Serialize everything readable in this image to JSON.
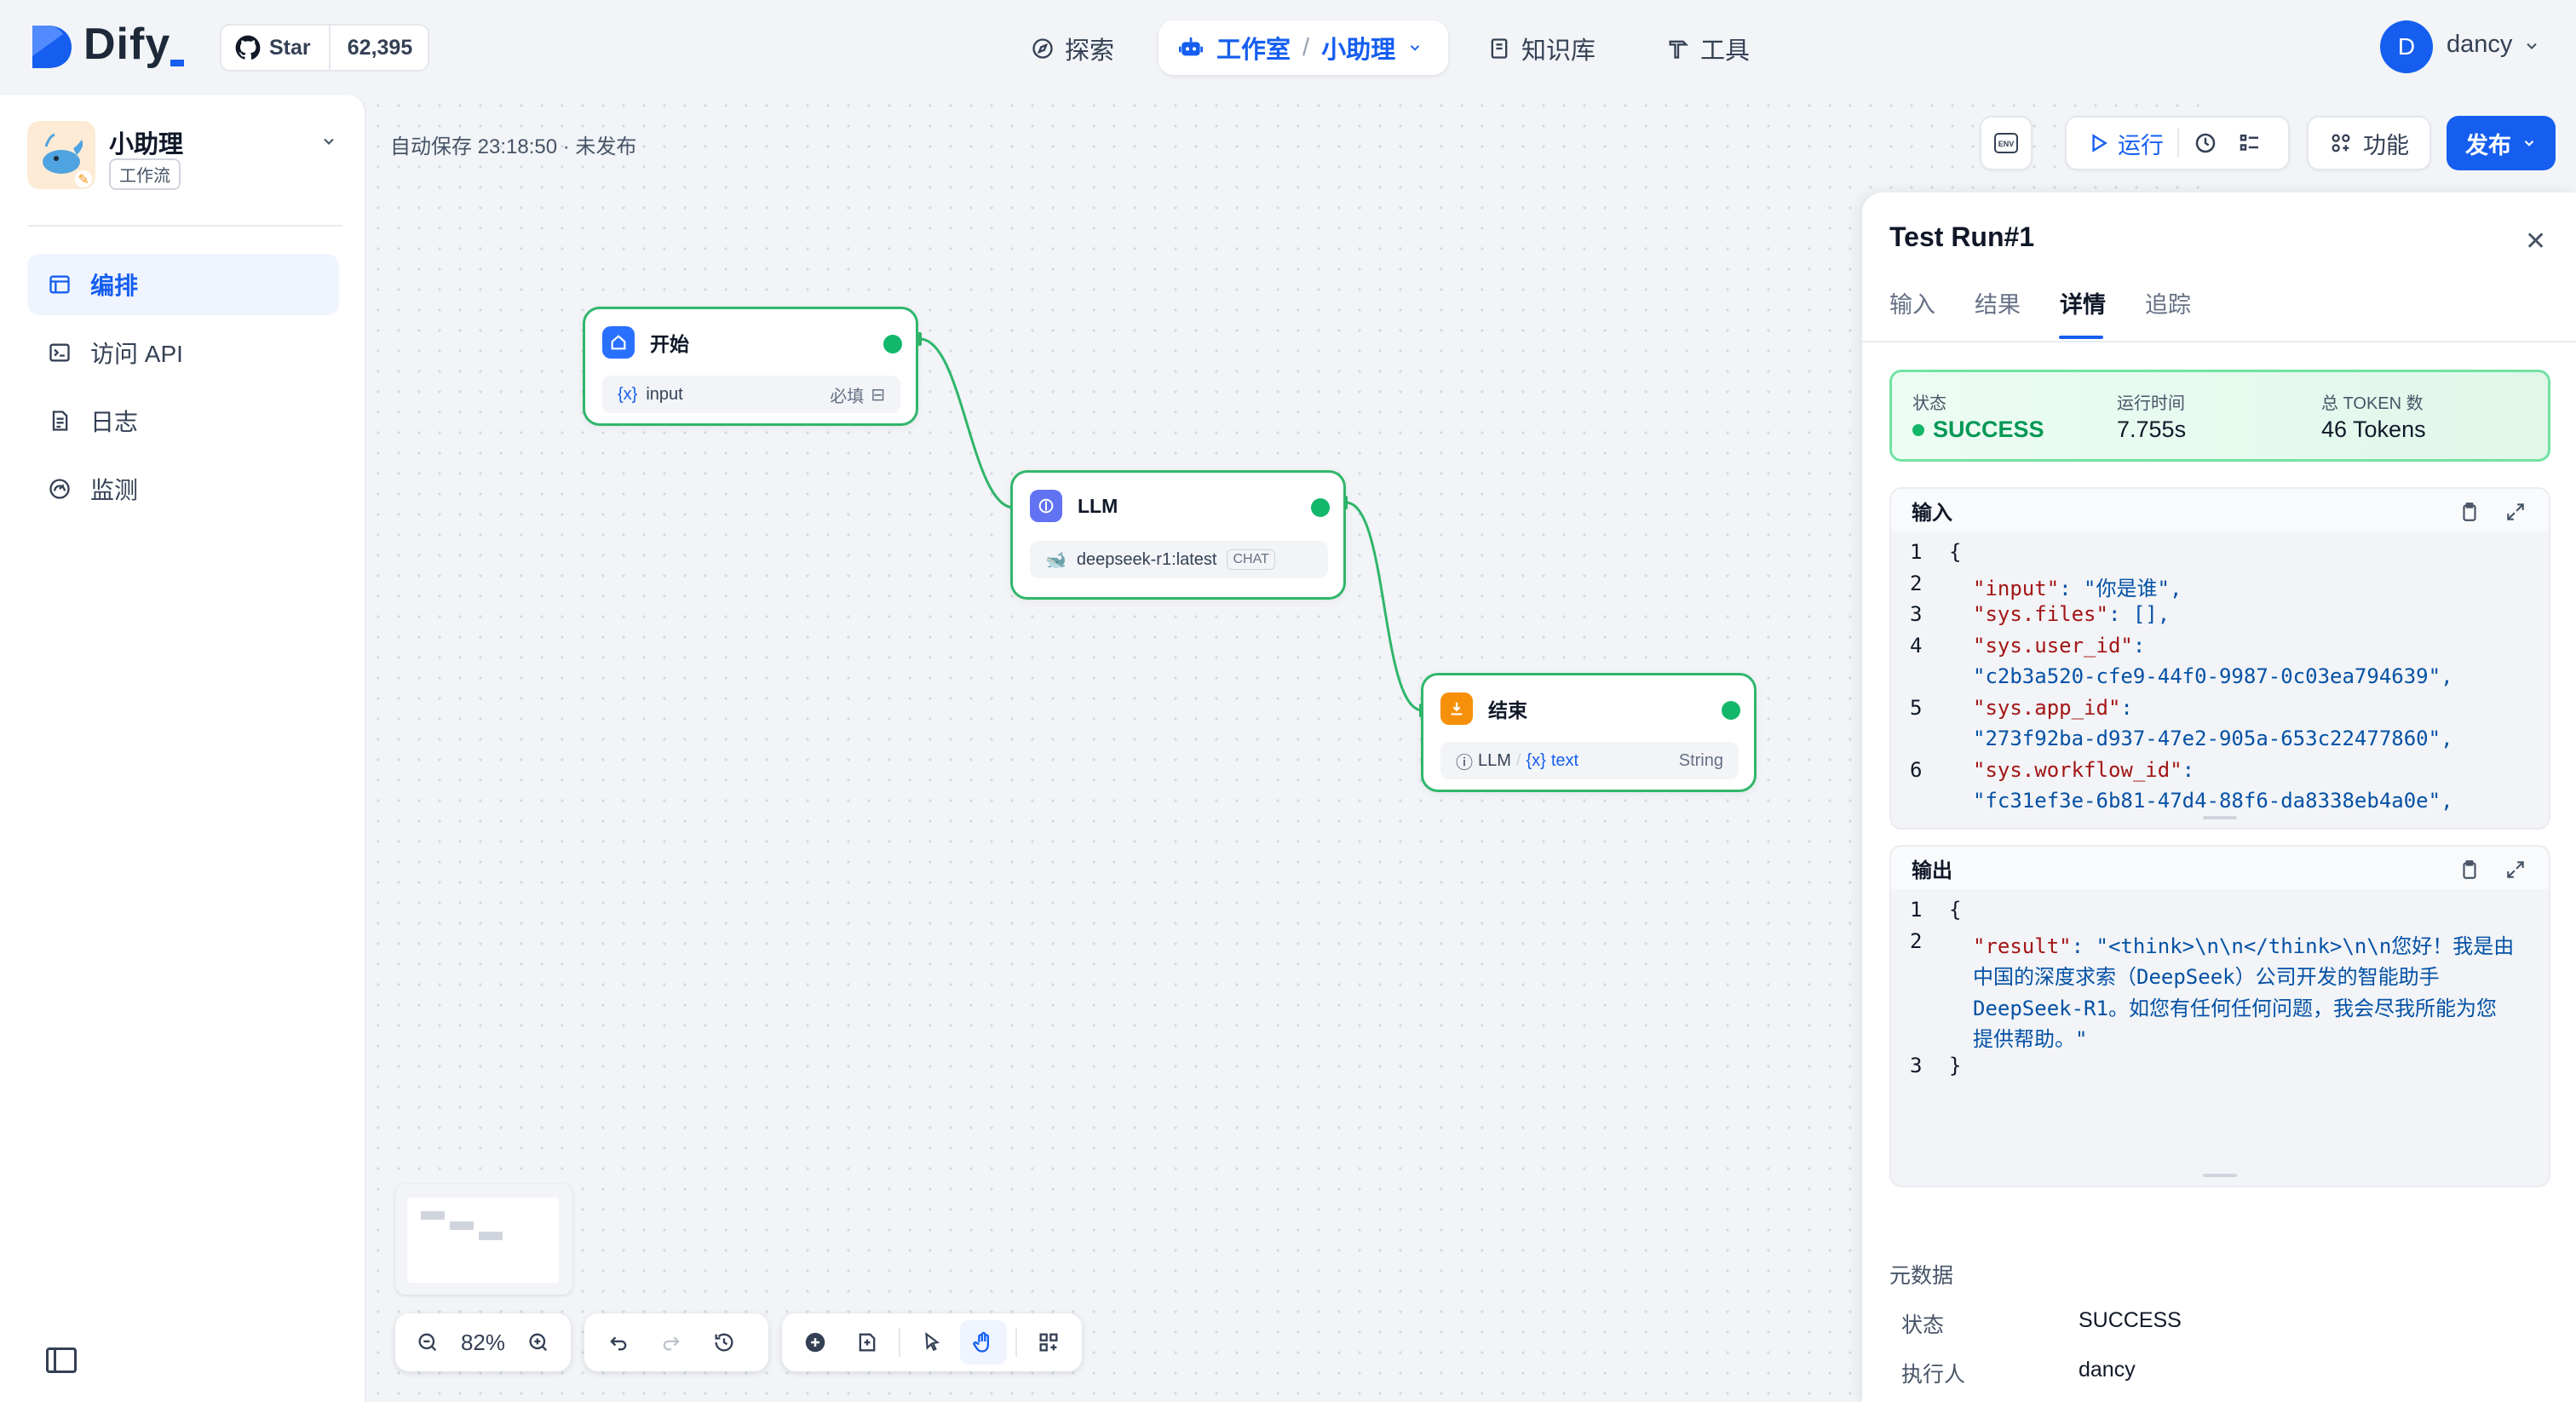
{
  "header": {
    "logo_text": "Dify",
    "github": {
      "star_label": "Star",
      "count": "62,395"
    },
    "nav": [
      {
        "label": "探索",
        "icon": "compass-icon"
      },
      {
        "label": "工作室",
        "icon": "robot-icon",
        "active": true,
        "crumb": "小助理"
      },
      {
        "label": "知识库",
        "icon": "book-icon"
      },
      {
        "label": "工具",
        "icon": "hammer-icon"
      }
    ],
    "user": {
      "initial": "D",
      "name": "dancy"
    }
  },
  "sidebar": {
    "app_name": "小助理",
    "app_type": "工作流",
    "items": [
      {
        "label": "编排",
        "icon": "layout-icon",
        "active": true
      },
      {
        "label": "访问 API",
        "icon": "terminal-icon"
      },
      {
        "label": "日志",
        "icon": "file-list-icon"
      },
      {
        "label": "监测",
        "icon": "dashboard-icon"
      }
    ]
  },
  "canvas": {
    "autosave": "自动保存 23:18:50 · 未发布",
    "nodes": {
      "start": {
        "title": "开始",
        "var_label": "input",
        "required": "必填"
      },
      "llm": {
        "title": "LLM",
        "model": "deepseek-r1:latest",
        "mode": "CHAT"
      },
      "end": {
        "title": "结束",
        "src": "LLM",
        "var": "text",
        "type": "String"
      }
    },
    "zoom": "82%"
  },
  "toolbar": {
    "run": "运行",
    "features": "功能",
    "publish": "发布",
    "env": "ENV"
  },
  "panel": {
    "title": "Test Run#1",
    "tabs": [
      "输入",
      "结果",
      "详情",
      "追踪"
    ],
    "active_tab": "详情",
    "status": {
      "status_label": "状态",
      "status_value": "SUCCESS",
      "time_label": "运行时间",
      "time_value": "7.755s",
      "token_label": "总 TOKEN 数",
      "token_value": "46 Tokens"
    },
    "input_title": "输入",
    "input_lines": [
      {
        "n": "1",
        "t": "{"
      },
      {
        "n": "2",
        "k": "\"input\"",
        "v": ": \"你是谁\","
      },
      {
        "n": "3",
        "k": "\"sys.files\"",
        "v": ": [],"
      },
      {
        "n": "4",
        "k": "\"sys.user_id\"",
        "v": ":"
      },
      {
        "n": "",
        "t2": "\"c2b3a520-cfe9-44f0-9987-0c03ea794639\","
      },
      {
        "n": "5",
        "k": "\"sys.app_id\"",
        "v": ":"
      },
      {
        "n": "",
        "t2": "\"273f92ba-d937-47e2-905a-653c22477860\","
      },
      {
        "n": "6",
        "k": "\"sys.workflow_id\"",
        "v": ":"
      },
      {
        "n": "",
        "t2": "\"fc31ef3e-6b81-47d4-88f6-da8338eb4a0e\","
      }
    ],
    "output_title": "输出",
    "output_lines": [
      {
        "n": "1",
        "t": "{"
      },
      {
        "n": "2",
        "k": "\"result\"",
        "v": ": \"<think>\\n\\n</think>\\n\\n您好！我是由"
      },
      {
        "n": "",
        "t2": "中国的深度求索（DeepSeek）公司开发的智能助手"
      },
      {
        "n": "",
        "t2": "DeepSeek-R1。如您有任何任何问题，我会尽我所能为您"
      },
      {
        "n": "",
        "t2": "提供帮助。\""
      },
      {
        "n": "3",
        "t": "}"
      }
    ],
    "meta_title": "元数据",
    "meta": [
      {
        "label": "状态",
        "value": "SUCCESS"
      },
      {
        "label": "执行人",
        "value": "dancy"
      }
    ]
  }
}
